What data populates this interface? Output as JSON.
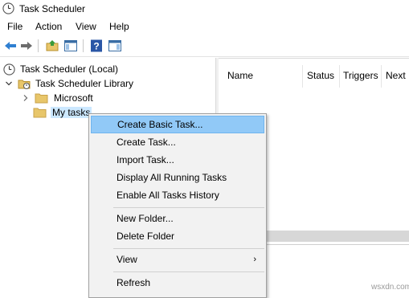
{
  "window": {
    "title": "Task Scheduler"
  },
  "menubar": {
    "items": [
      "File",
      "Action",
      "View",
      "Help"
    ]
  },
  "toolbar": {
    "buttons": [
      "back-arrow-icon",
      "forward-arrow-icon",
      "up-folder-icon",
      "show-hide-console-tree-icon",
      "help-icon",
      "show-hide-action-pane-icon"
    ]
  },
  "tree": {
    "root": "Task Scheduler (Local)",
    "library": "Task Scheduler Library",
    "microsoft": "Microsoft",
    "mytasks": "My tasks"
  },
  "list": {
    "columns": [
      "Name",
      "Status",
      "Triggers",
      "Next"
    ]
  },
  "context_menu": {
    "create_basic_task": "Create Basic Task...",
    "create_task": "Create Task...",
    "import_task": "Import Task...",
    "display_running": "Display All Running Tasks",
    "enable_history": "Enable All Tasks History",
    "new_folder": "New Folder...",
    "delete_folder": "Delete Folder",
    "view": "View",
    "refresh": "Refresh"
  },
  "watermark": "wsxdn.com",
  "colors": {
    "highlight": "#91c9f7",
    "selection": "#cce8ff",
    "folder": "#e8c66a"
  }
}
